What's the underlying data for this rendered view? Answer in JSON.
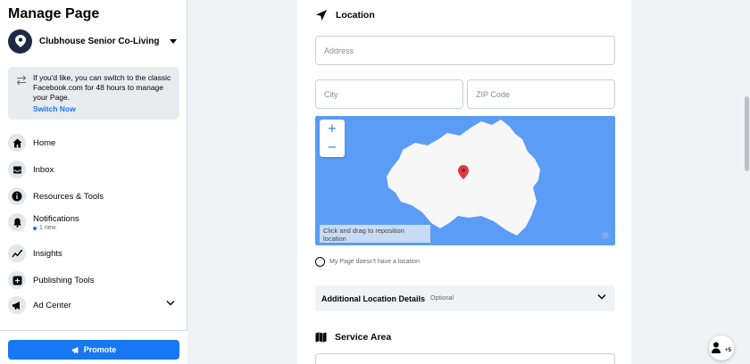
{
  "sidebar": {
    "title": "Manage Page",
    "page_name": "Clubhouse Senior Co-Living",
    "notice": {
      "text": "If you'd like, you can switch to the classic Facebook.com for 48 hours to manage your Page.",
      "link": "Switch Now"
    },
    "items": [
      {
        "label": "Home",
        "icon": "home-icon"
      },
      {
        "label": "Inbox",
        "icon": "inbox-icon"
      },
      {
        "label": "Resources & Tools",
        "icon": "info-icon"
      },
      {
        "label": "Notifications",
        "icon": "bell-icon",
        "sub": "1 new"
      },
      {
        "label": "Insights",
        "icon": "insights-icon"
      },
      {
        "label": "Publishing Tools",
        "icon": "publishing-icon"
      },
      {
        "label": "Ad Center",
        "icon": "megaphone-icon"
      }
    ],
    "promote_label": "Promote"
  },
  "location": {
    "title": "Location",
    "address_placeholder": "Address",
    "city_placeholder": "City",
    "zip_placeholder": "ZIP Code",
    "map": {
      "zoom_in": "+",
      "zoom_out": "−",
      "hint": "Click and drag to reposition location",
      "water_color": "#5b9cf6",
      "pin_color": "#e0393e"
    },
    "no_location_label": "My Page doesn't have a location",
    "additional_title": "Additional Location Details",
    "additional_optional": "Optional"
  },
  "service_area": {
    "title": "Service Area"
  },
  "fab": {
    "badge": "+5"
  },
  "colors": {
    "accent": "#1877f2",
    "page_bg": "#f0f2f5"
  }
}
